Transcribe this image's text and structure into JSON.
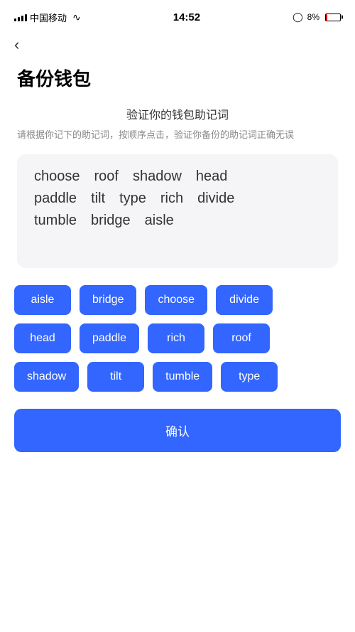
{
  "statusBar": {
    "carrier": "中国移动",
    "time": "14:52",
    "batteryPercent": "8%"
  },
  "nav": {
    "backLabel": "‹"
  },
  "pageTitle": "备份钱包",
  "verifySection": {
    "title": "验证你的钱包助记词",
    "description": "请根据你记下的助记词，按顺序点击，验证你备份的助记词正确无误"
  },
  "displayWords": {
    "row1": [
      "choose",
      "roof",
      "shadow",
      "head"
    ],
    "row2": [
      "paddle",
      "tilt",
      "type",
      "rich",
      "divide"
    ],
    "row3": [
      "tumble",
      "bridge",
      "aisle"
    ]
  },
  "wordButtons": {
    "row1": [
      "aisle",
      "bridge",
      "choose",
      "divide"
    ],
    "row2": [
      "head",
      "paddle",
      "rich",
      "roof"
    ],
    "row3": [
      "shadow",
      "tilt",
      "tumble",
      "type"
    ]
  },
  "confirmButton": {
    "label": "确认"
  },
  "colors": {
    "blue": "#3366ff",
    "textDark": "#333333",
    "textGray": "#888888",
    "bgLight": "#f5f5f7"
  }
}
